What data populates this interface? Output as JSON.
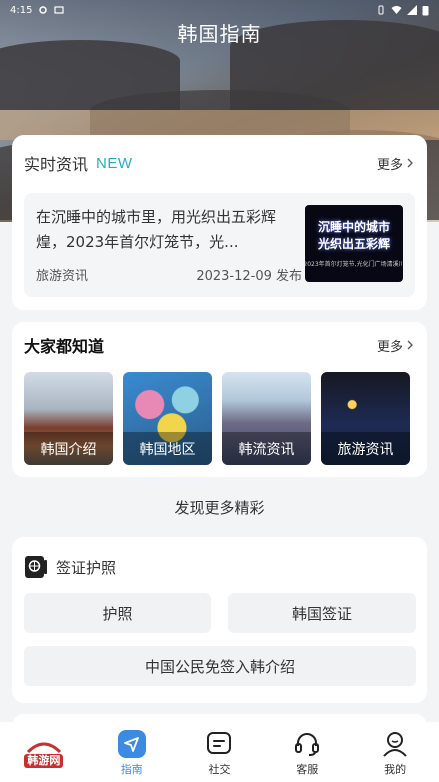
{
  "status_bar": {
    "time": "4:15"
  },
  "header": {
    "title": "韩国指南"
  },
  "news": {
    "title": "实时资讯",
    "badge": "NEW",
    "more": "更多",
    "item": {
      "title": "在沉睡中的城市里，用光织出五彩辉煌，2023年首尔灯笼节，光...",
      "category": "旅游资讯",
      "date": "2023-12-09 发布",
      "thumb_line1": "沉睡中的城市",
      "thumb_line2": "光织出五彩辉",
      "thumb_line3": "2023年首尔灯笼节,光化门广场清溪川"
    }
  },
  "know": {
    "title": "大家都知道",
    "more": "更多",
    "tiles": [
      {
        "label": "韩国介绍"
      },
      {
        "label": "韩国地区"
      },
      {
        "label": "韩流资讯"
      },
      {
        "label": "旅游资讯"
      }
    ]
  },
  "discover": "发现更多精彩",
  "visa": {
    "title": "签证护照",
    "buttons": [
      "护照",
      "韩国签证",
      "中国公民免签入韩介绍"
    ]
  },
  "tabbar": {
    "logo_text": "韩游网",
    "items": [
      {
        "label": "指南",
        "icon": "send-icon"
      },
      {
        "label": "社交",
        "icon": "chat-icon"
      },
      {
        "label": "客服",
        "icon": "headset-icon"
      },
      {
        "label": "我的",
        "icon": "user-icon"
      }
    ]
  },
  "colors": {
    "accent": "#3b8be3",
    "new_badge": "#29a9c9"
  }
}
